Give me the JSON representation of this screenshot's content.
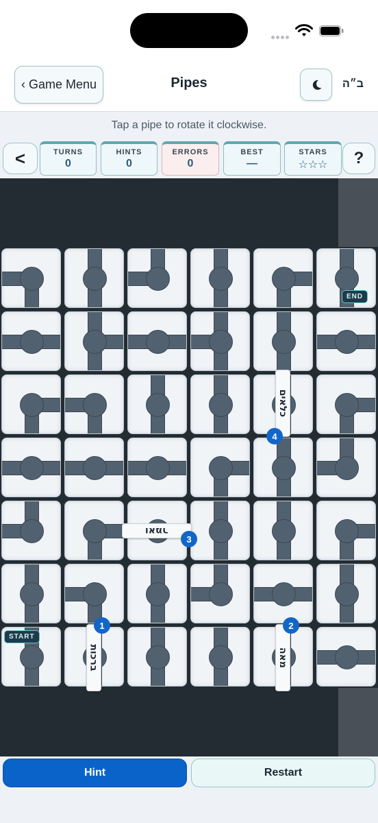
{
  "header": {
    "menu_label": "‹ Game Menu",
    "title": "Pipes",
    "bh": "ב״ה"
  },
  "instruction": "Tap a pipe to rotate it clockwise.",
  "stats": {
    "back_label": "<",
    "help_label": "?",
    "turns": {
      "label": "TURNS",
      "value": "0"
    },
    "hints": {
      "label": "HINTS",
      "value": "0"
    },
    "errors": {
      "label": "ERRORS",
      "value": "0"
    },
    "best": {
      "label": "BEST",
      "value": "—"
    },
    "stars": {
      "label": "STARS",
      "value": "☆☆☆"
    }
  },
  "board": {
    "start_label": "START",
    "end_label": "END",
    "grid": [
      [
        "lb",
        "tb",
        "lt",
        "tb",
        "rb",
        "tb"
      ],
      [
        "lr",
        "tbr",
        "lr",
        "ltb",
        "tb",
        "lr"
      ],
      [
        "rb",
        "lb",
        "tb",
        "tb",
        "tb",
        "rb"
      ],
      [
        "lr",
        "lr",
        "lr",
        "rb",
        "tb",
        "lt"
      ],
      [
        "lt",
        "rb",
        "lr",
        "tb",
        "tb",
        "rb"
      ],
      [
        "tb",
        "lb",
        "tb",
        "lt",
        "lr",
        "tb"
      ],
      [
        "tb",
        "tb",
        "tb",
        "tb",
        "tb",
        "lr"
      ]
    ],
    "word_cards": [
      {
        "number": "1",
        "word": "ברכות"
      },
      {
        "number": "2",
        "word": "מאה"
      },
      {
        "number": "3",
        "word": "ואמר"
      },
      {
        "number": "4",
        "word": "כלאים"
      }
    ]
  },
  "actions": {
    "hint_label": "Hint",
    "restart_label": "Restart"
  },
  "colors": {
    "primary": "#0a63c9",
    "board_bg": "#232c33",
    "pipe": "#52616f",
    "badge": "#1266c8"
  }
}
